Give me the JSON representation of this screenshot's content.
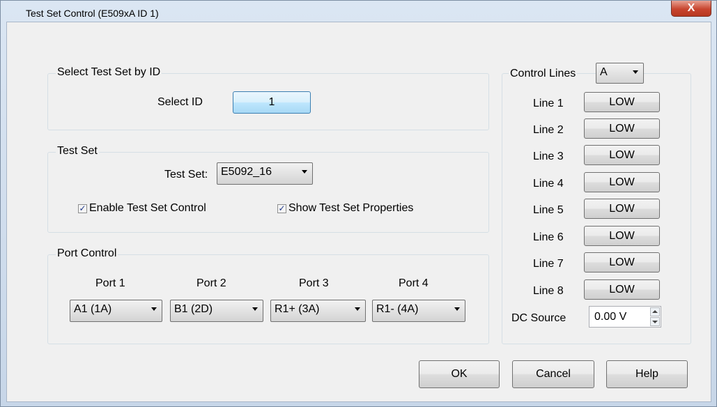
{
  "window": {
    "title": "Test Set Control (E509xA ID 1)",
    "close_glyph": "X"
  },
  "select_test_set": {
    "group_label": "Select Test Set by ID",
    "select_id_label": "Select ID",
    "select_id_value": "1"
  },
  "test_set": {
    "group_label": "Test Set",
    "test_set_label": "Test Set:",
    "test_set_value": "E5092_16",
    "enable_label": "Enable Test Set Control",
    "enable_checked": true,
    "show_props_label": "Show Test Set Properties",
    "show_props_checked": true,
    "check_glyph": "✓"
  },
  "port_control": {
    "group_label": "Port Control",
    "ports": [
      {
        "label": "Port 1",
        "value": "A1 (1A)"
      },
      {
        "label": "Port 2",
        "value": "B1 (2D)"
      },
      {
        "label": "Port 3",
        "value": "R1+ (3A)"
      },
      {
        "label": "Port 4",
        "value": "R1- (4A)"
      }
    ]
  },
  "control_lines": {
    "group_label": "Control Lines",
    "selected": "A",
    "lines": [
      {
        "label": "Line 1",
        "state": "LOW"
      },
      {
        "label": "Line 2",
        "state": "LOW"
      },
      {
        "label": "Line 3",
        "state": "LOW"
      },
      {
        "label": "Line 4",
        "state": "LOW"
      },
      {
        "label": "Line 5",
        "state": "LOW"
      },
      {
        "label": "Line 6",
        "state": "LOW"
      },
      {
        "label": "Line 7",
        "state": "LOW"
      },
      {
        "label": "Line 8",
        "state": "LOW"
      }
    ],
    "dc_source_label": "DC Source",
    "dc_source_value": "0.00 V"
  },
  "buttons": {
    "ok": "OK",
    "cancel": "Cancel",
    "help": "Help"
  },
  "colors": {
    "close_button": "#c8452f",
    "focus_button": "#bee6fd",
    "check_mark": "#21398a"
  }
}
